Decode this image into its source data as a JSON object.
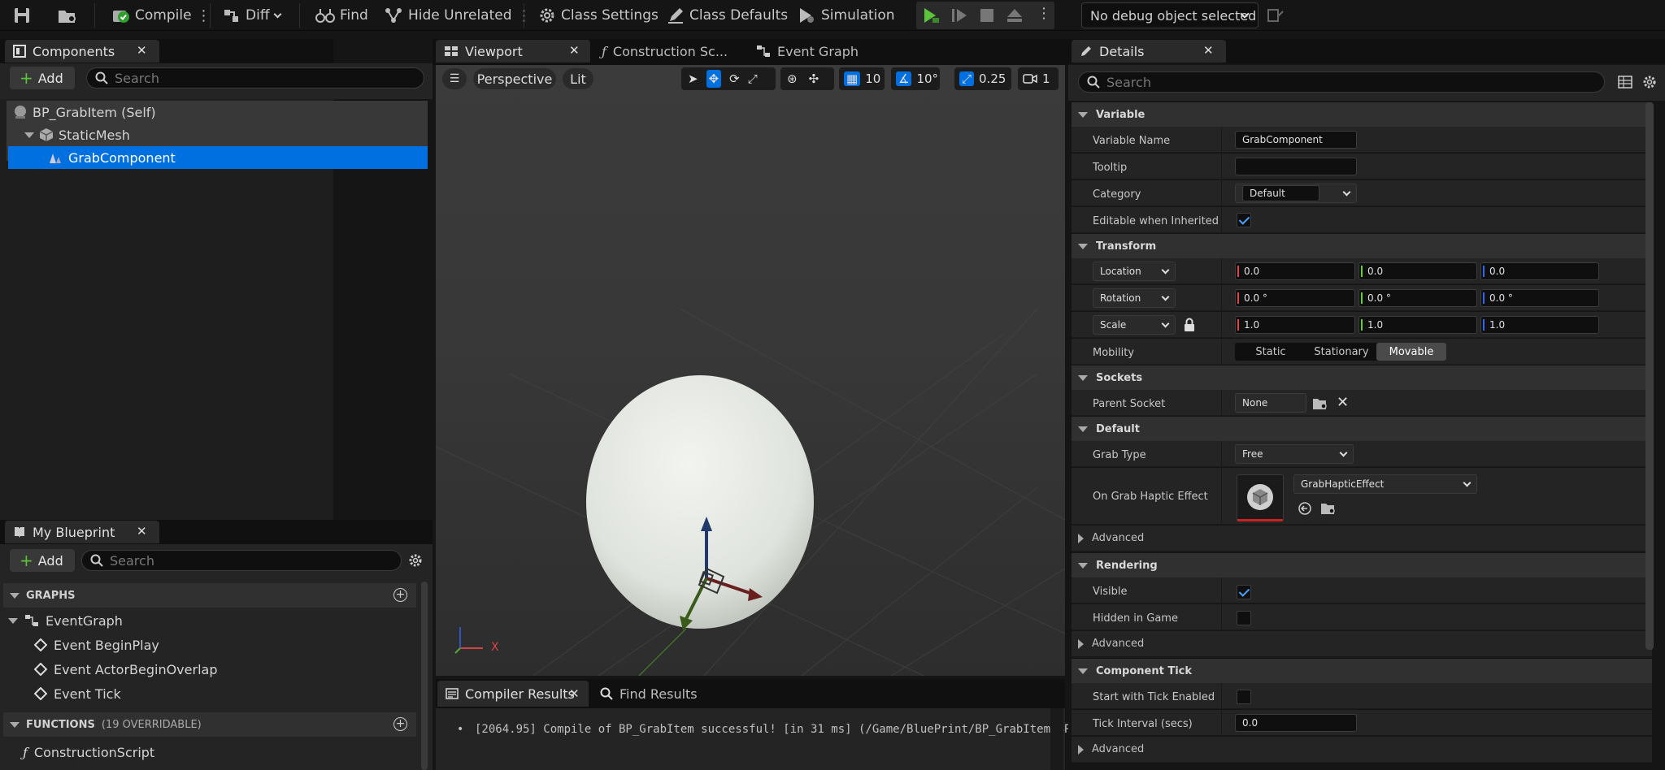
{
  "toolbar": {
    "compile": "Compile",
    "diff": "Diff",
    "find": "Find",
    "hide_unrelated": "Hide Unrelated",
    "class_settings": "Class Settings",
    "class_defaults": "Class Defaults",
    "simulation": "Simulation",
    "debug_object": "No debug object selected"
  },
  "components_panel": {
    "tab": "Components",
    "add": "Add",
    "search_placeholder": "Search",
    "items": [
      "BP_GrabItem (Self)",
      "StaticMesh",
      "GrabComponent"
    ]
  },
  "my_blueprint": {
    "tab": "My Blueprint",
    "add": "Add",
    "search_placeholder": "Search",
    "graphs_header": "GRAPHS",
    "event_graph": "EventGraph",
    "events": [
      "Event BeginPlay",
      "Event ActorBeginOverlap",
      "Event Tick"
    ],
    "functions_header": "FUNCTIONS",
    "functions_count": "(19 OVERRIDABLE)",
    "construction_script": "ConstructionScript"
  },
  "editor_tabs": [
    "Viewport",
    "Construction Sc...",
    "Event Graph"
  ],
  "viewport": {
    "perspective": "Perspective",
    "lit": "Lit",
    "grid_snap": "10",
    "rot_snap": "10°",
    "scale_snap": "0.25",
    "camera_speed": "1",
    "axis_x": "X"
  },
  "bottom_tabs": [
    "Compiler Results",
    "Find Results"
  ],
  "compiler_log": "[2064.95] Compile of BP_GrabItem successful! [in 31 ms] (/Game/BluePrint/BP_GrabItem.BP_GrabItem)",
  "details": {
    "tab": "Details",
    "search_placeholder": "Search",
    "sections": {
      "variable": "Variable",
      "transform": "Transform",
      "sockets": "Sockets",
      "default": "Default",
      "rendering": "Rendering",
      "component_tick": "Component Tick"
    },
    "advanced": "Advanced",
    "variable_name_label": "Variable Name",
    "variable_name": "GrabComponent",
    "tooltip_label": "Tooltip",
    "tooltip": "",
    "category_label": "Category",
    "category": "Default",
    "editable_label": "Editable when Inherited",
    "location_label": "Location",
    "location": [
      "0.0",
      "0.0",
      "0.0"
    ],
    "rotation_label": "Rotation",
    "rotation": [
      "0.0 °",
      "0.0 °",
      "0.0 °"
    ],
    "scale_label": "Scale",
    "scale": [
      "1.0",
      "1.0",
      "1.0"
    ],
    "mobility_label": "Mobility",
    "mobility_options": [
      "Static",
      "Stationary",
      "Movable"
    ],
    "mobility_selected": "Movable",
    "parent_socket_label": "Parent Socket",
    "parent_socket": "None",
    "grab_type_label": "Grab Type",
    "grab_type": "Free",
    "haptic_label": "On Grab Haptic Effect",
    "haptic": "GrabHapticEffect",
    "visible_label": "Visible",
    "hidden_label": "Hidden in Game",
    "tick_enabled_label": "Start with Tick Enabled",
    "tick_interval_label": "Tick Interval (secs)",
    "tick_interval": "0.0"
  },
  "colors": {
    "accent": "#0070e0",
    "play_green": "#5ac43a",
    "background": "#151515",
    "panel": "#242424"
  }
}
